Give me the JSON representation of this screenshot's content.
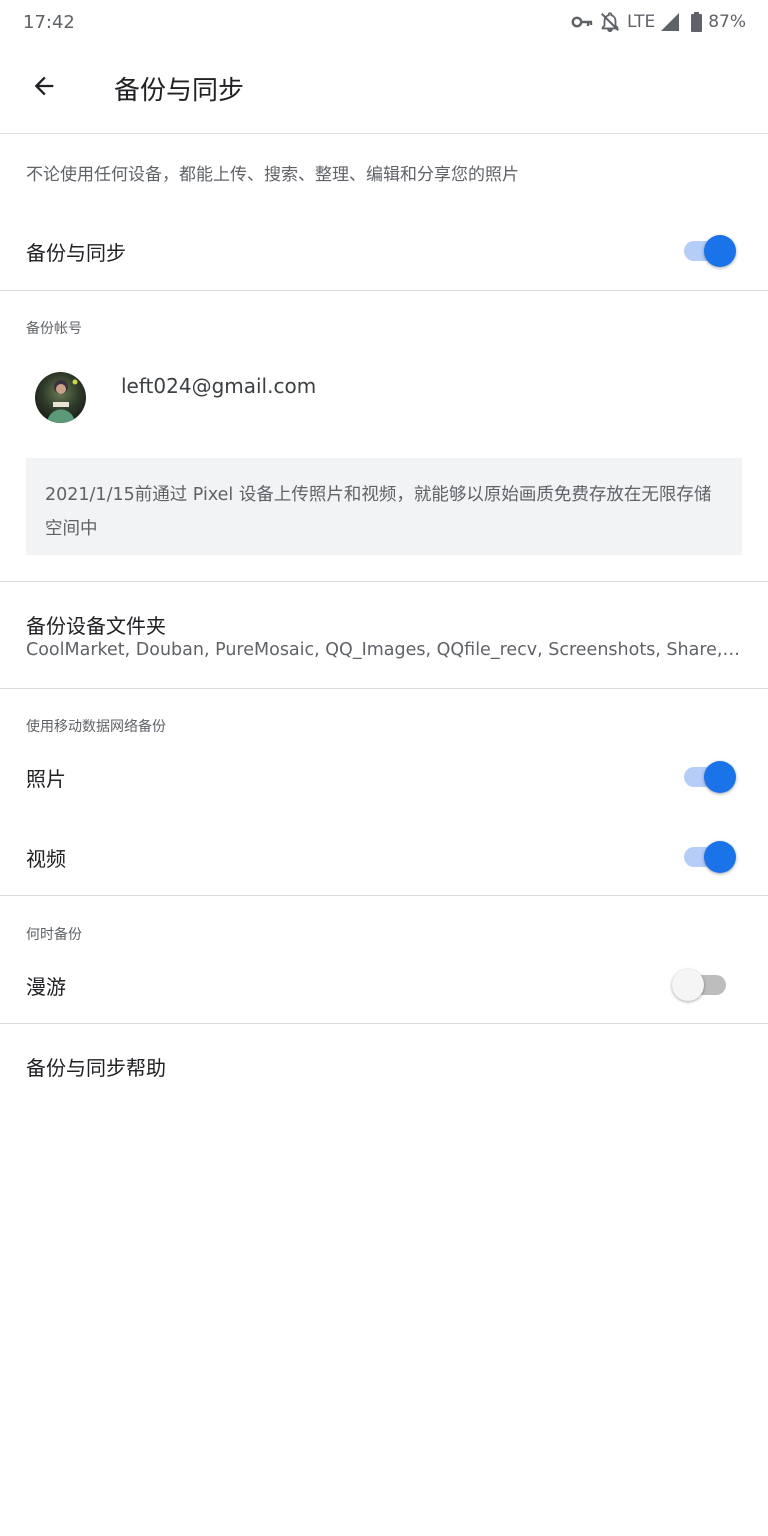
{
  "status_bar": {
    "time": "17:42",
    "network": "LTE",
    "battery": "87%",
    "icons": [
      "vpn-key-icon",
      "notifications-off-icon",
      "signal-icon",
      "battery-icon"
    ]
  },
  "app_bar": {
    "back_icon": "arrow-back-icon",
    "title": "备份与同步"
  },
  "intro": "不论使用任何设备，都能上传、搜索、整理、编辑和分享您的照片",
  "backup_sync": {
    "label": "备份与同步",
    "enabled": true
  },
  "account": {
    "header": "备份帐号",
    "email": "left024@gmail.com",
    "notice": "2021/1/15前通过 Pixel 设备上传照片和视频，就能够以原始画质免费存放在无限存储空间中"
  },
  "folders": {
    "title": "备份设备文件夹",
    "list": "CoolMarket, Douban, PureMosaic, QQ_Images, QQfile_recv, Screenshots, Share, Share, Sina"
  },
  "mobile_data": {
    "header": "使用移动数据网络备份",
    "items": [
      {
        "label": "照片",
        "enabled": true
      },
      {
        "label": "视频",
        "enabled": true
      }
    ]
  },
  "when": {
    "header": "何时备份",
    "roaming": {
      "label": "漫游",
      "enabled": false
    }
  },
  "help": "备份与同步帮助",
  "colors": {
    "accent": "#1a73e8",
    "accent_track": "#b6cdf7",
    "off_track": "#bdbdbd",
    "notice_bg": "#f1f3f4"
  }
}
